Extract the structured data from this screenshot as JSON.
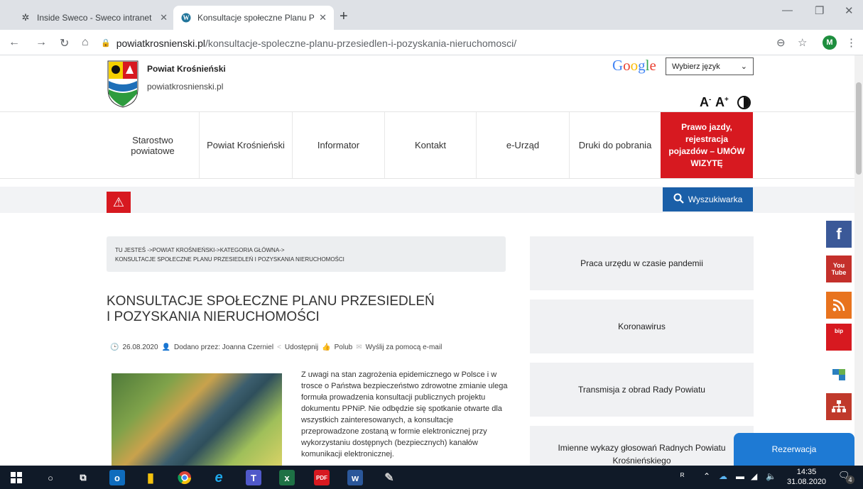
{
  "browser": {
    "tabs": [
      {
        "title": "Inside Sweco - Sweco intranet",
        "close": "✕"
      },
      {
        "title": "Konsultacje społeczne Planu Prze",
        "close": "✕"
      }
    ],
    "new_tab": "+",
    "url_host": "powiatkrosnienski.pl",
    "url_path": "/konsultacje-spoleczne-planu-przesiedlen-i-pozyskania-nieruchomosci/",
    "avatar_letter": "M"
  },
  "header": {
    "site_name": "Powiat Krośnieński",
    "site_url": "powiatkrosnienski.pl",
    "google_label": "Google",
    "language_select": "Wybierz język",
    "font_decrease": "A",
    "font_increase": "A"
  },
  "nav": {
    "items": [
      "Starostwo powiatowe",
      "Powiat Krośnieński",
      "Informator",
      "Kontakt",
      "e-Urząd",
      "Druki do pobrania"
    ],
    "cta": "Prawo jazdy, rejestracja pojazdów – UMÓW WIZYTĘ"
  },
  "search_button": "Wyszukiwarka",
  "breadcrumb": {
    "line1": "TU JESTEŚ ->POWIAT KROŚNIEŃSKI->KATEGORIA GŁÓWNA->",
    "line2": "KONSULTACJE SPOŁECZNE PLANU PRZESIEDLEŃ I POZYSKANIA NIERUCHOMOŚCI"
  },
  "article": {
    "title": "KONSULTACJE SPOŁECZNE PLANU PRZESIEDLEŃ I POZYSKANIA NIERUCHOMOŚCI",
    "date": "26.08.2020",
    "author": "Dodano przez: Joanna Czerniel",
    "share": "Udostępnij",
    "like": "Polub",
    "email": "Wyślij za pomocą e-mail",
    "text": "Z uwagi na stan zagrożenia epidemicznego w Polsce i w trosce o Państwa bezpieczeństwo zdrowotne zmianie ulega formuła prowadzenia konsultacji publicznych projektu dokumentu PPNiP. Nie odbędzie się spotkanie otwarte dla wszystkich zainteresowanych, a konsultacje przeprowadzone zostaną w formie elektronicznej przy wykorzystaniu dostępnych (bezpiecznych) kanałów komunikacji elektronicznej."
  },
  "sidebar": {
    "boxes": [
      "Praca urzędu w czasie pandemii",
      "Koronawirus",
      "Transmisja z obrad Rady Powiatu",
      "Imienne wykazy głosowań Radnych Powiatu Krośnieńskiego"
    ]
  },
  "social": {
    "facebook": "f",
    "youtube": "You Tube",
    "bip": "bip"
  },
  "reservation": "Rezerwacja",
  "taskbar": {
    "time": "14:35",
    "date": "31.08.2020",
    "notifications": "4"
  },
  "colors": {
    "accent_red": "#d71920",
    "accent_blue": "#1a5fa8"
  }
}
